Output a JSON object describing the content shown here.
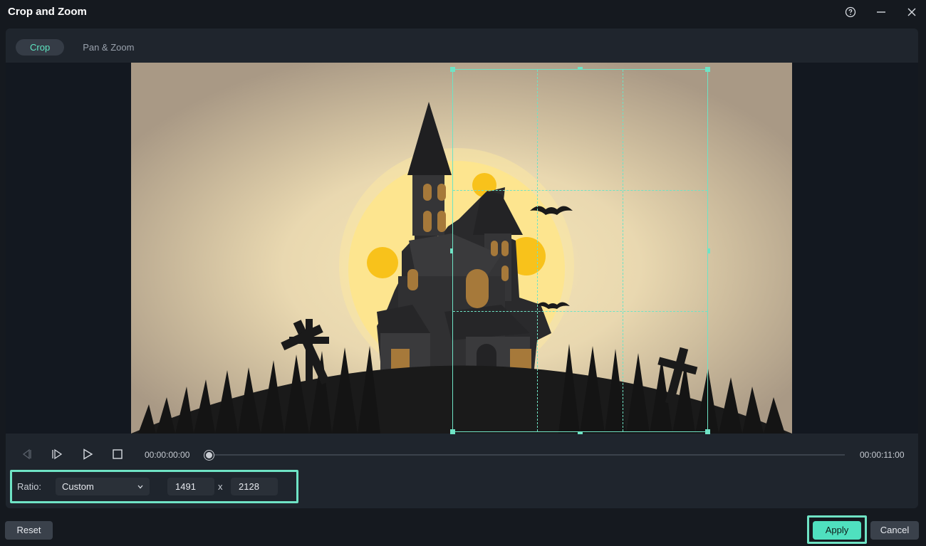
{
  "window": {
    "title": "Crop and Zoom",
    "controls": [
      "help-icon",
      "minimize-icon",
      "close-icon"
    ]
  },
  "tabs": [
    {
      "label": "Crop",
      "active": true
    },
    {
      "label": "Pan & Zoom",
      "active": false
    }
  ],
  "player": {
    "current_time": "00:00:00:00",
    "total_time": "00:00:11:00",
    "progress": 0,
    "buttons": [
      "previous-frame-icon",
      "next-frame-icon",
      "play-icon",
      "stop-icon"
    ]
  },
  "ratio": {
    "label": "Ratio:",
    "selected": "Custom",
    "width": "1491",
    "separator": "x",
    "height": "2128"
  },
  "footer": {
    "reset_label": "Reset",
    "apply_label": "Apply",
    "cancel_label": "Cancel"
  },
  "colors": {
    "accent": "#5ee6c2",
    "crop_border": "#6fe3c5",
    "background": "#15191f",
    "panel": "#1f252d"
  }
}
